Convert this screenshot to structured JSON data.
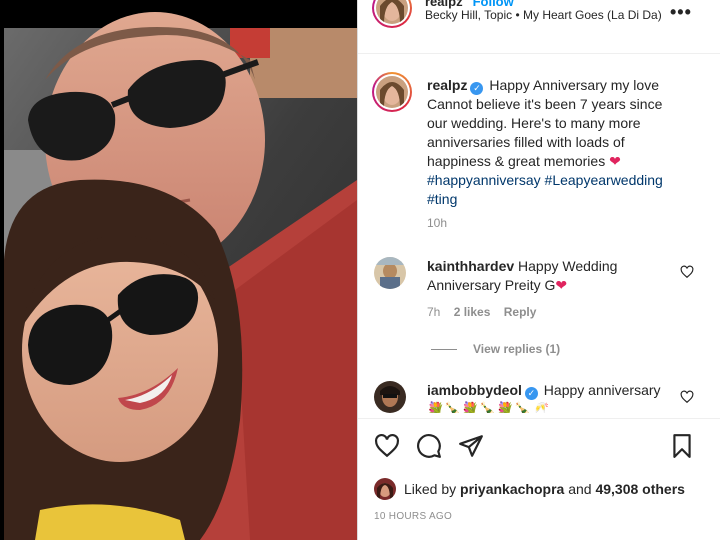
{
  "post": {
    "username": "realpz",
    "follow_label": "Follow",
    "music": "Becky Hill, Topic • My Heart Goes (La Di Da)",
    "more_label": "•••"
  },
  "caption": {
    "username": "realpz",
    "text": "Happy Anniversary my love Cannot believe it's been 7 years since our wedding. Here's to many more anniversaries filled with loads of happiness & great memories",
    "emoji": "❤",
    "hashtags": [
      "#happyanniversay",
      "#Leapyearwedding",
      "#ting"
    ],
    "time": "10h"
  },
  "comments": [
    {
      "username": "kainthhardev",
      "text": "Happy Wedding Anniversary Preity G",
      "emoji": "❤",
      "time": "7h",
      "likes": "2 likes",
      "reply": "Reply",
      "view_replies": "View replies (1)"
    },
    {
      "username": "iambobbydeol",
      "text": "Happy anniversary",
      "emoji": "💐🍾💐🍾💐🍾🥂"
    }
  ],
  "actions": {
    "liked_by_prefix": "Liked by",
    "liked_by_user": "priyankachopra",
    "liked_by_and": "and",
    "liked_by_count": "49,308 others",
    "timestamp": "10 HOURS AGO"
  },
  "icons": [
    "heart-icon",
    "comment-icon",
    "share-icon",
    "bookmark-icon",
    "more-options-icon",
    "verified-badge-icon"
  ],
  "colors": {
    "link": "#00376b",
    "verified": "#3897f0",
    "heart": "#e0245e",
    "muted": "#8e8e8e"
  }
}
